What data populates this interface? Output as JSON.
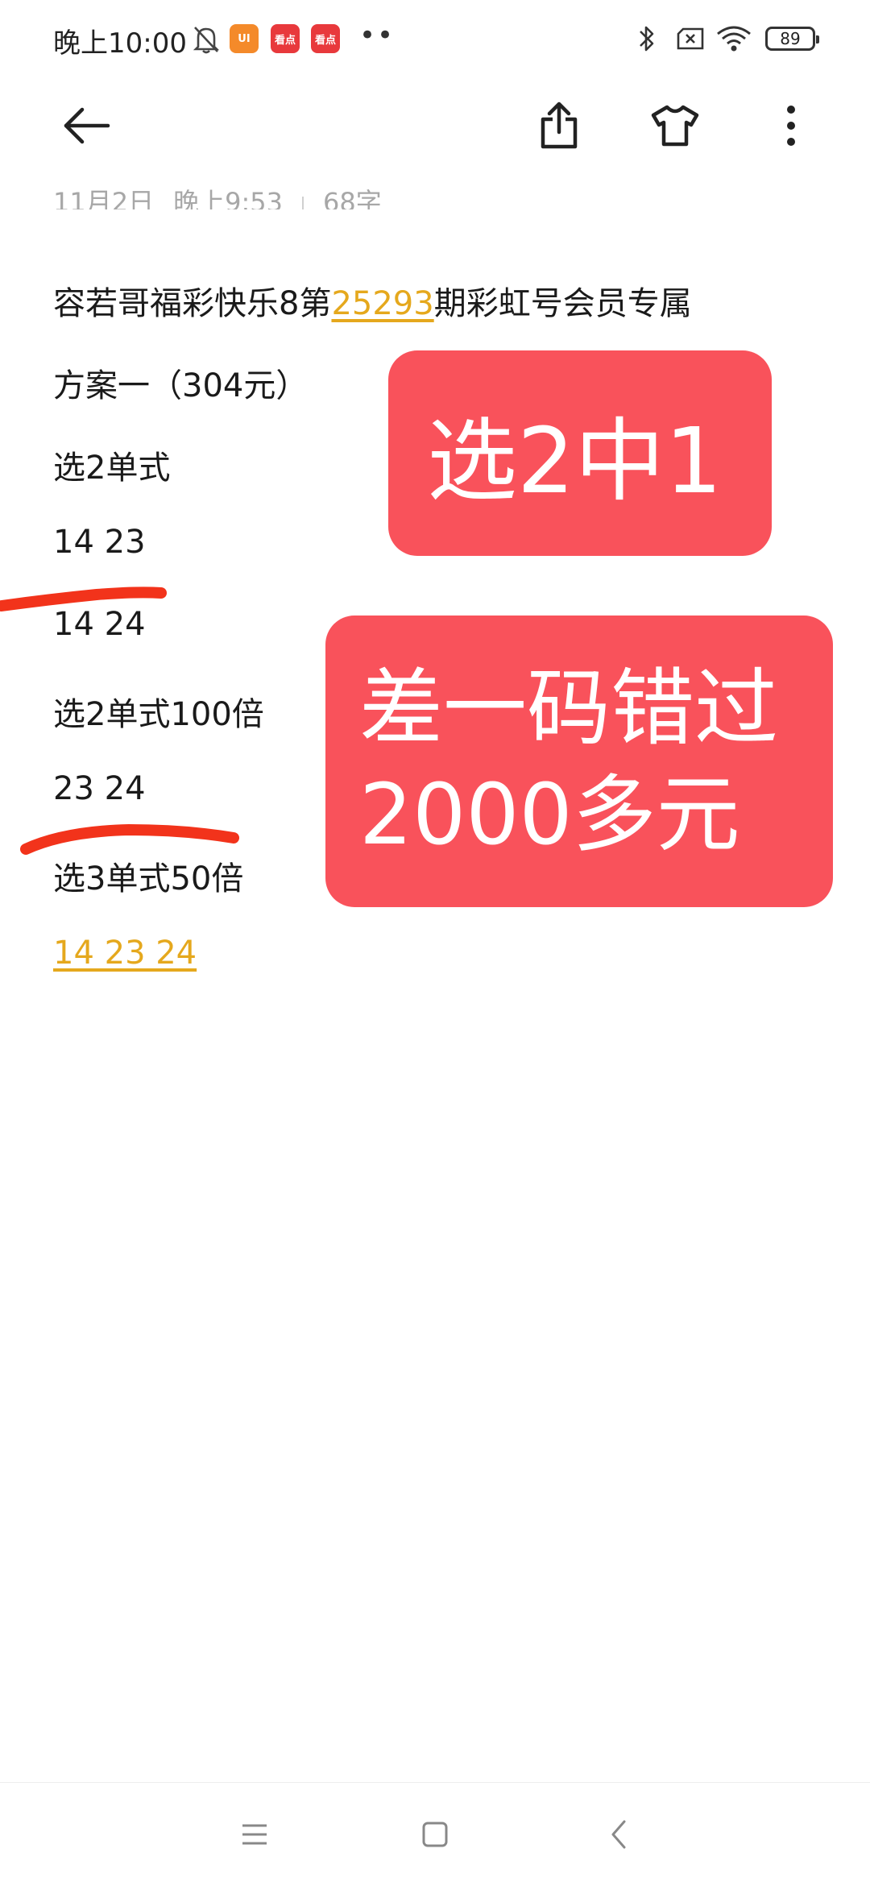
{
  "status_bar": {
    "time": "晚上10:00",
    "app_badge_1": "UI",
    "app_badge_2": "看点",
    "app_badge_3": "看点",
    "more_dots": "••",
    "battery": "89"
  },
  "toolbar": {
    "back_icon": "arrow-left-icon",
    "share_icon": "share-icon",
    "theme_icon": "tshirt-icon",
    "more_icon": "more-vertical-icon"
  },
  "note": {
    "meta": {
      "date": "11月2日",
      "time": "晚上9:53",
      "chars": "68字"
    },
    "title_prefix": "容若哥福彩快乐8第",
    "title_issue": "25293",
    "title_suffix": "期彩虹号会员专属",
    "lines": [
      "方案一（304元）",
      "选2单式",
      "14 23",
      "14 24",
      "选2单式100倍",
      "23 24",
      "选3单式50倍"
    ],
    "last_line": "14 23 24"
  },
  "overlays": {
    "box1": "选2中1",
    "box2_line1": "差一码错过",
    "box2_line2": "2000多元"
  },
  "colors": {
    "overlay_red": "#f9525b",
    "highlight": "#e5a81d",
    "stroke_red": "#f2331b"
  },
  "nav": {
    "menu_icon": "menu-icon",
    "home_icon": "home-square-icon",
    "back_icon": "chevron-left-icon"
  }
}
